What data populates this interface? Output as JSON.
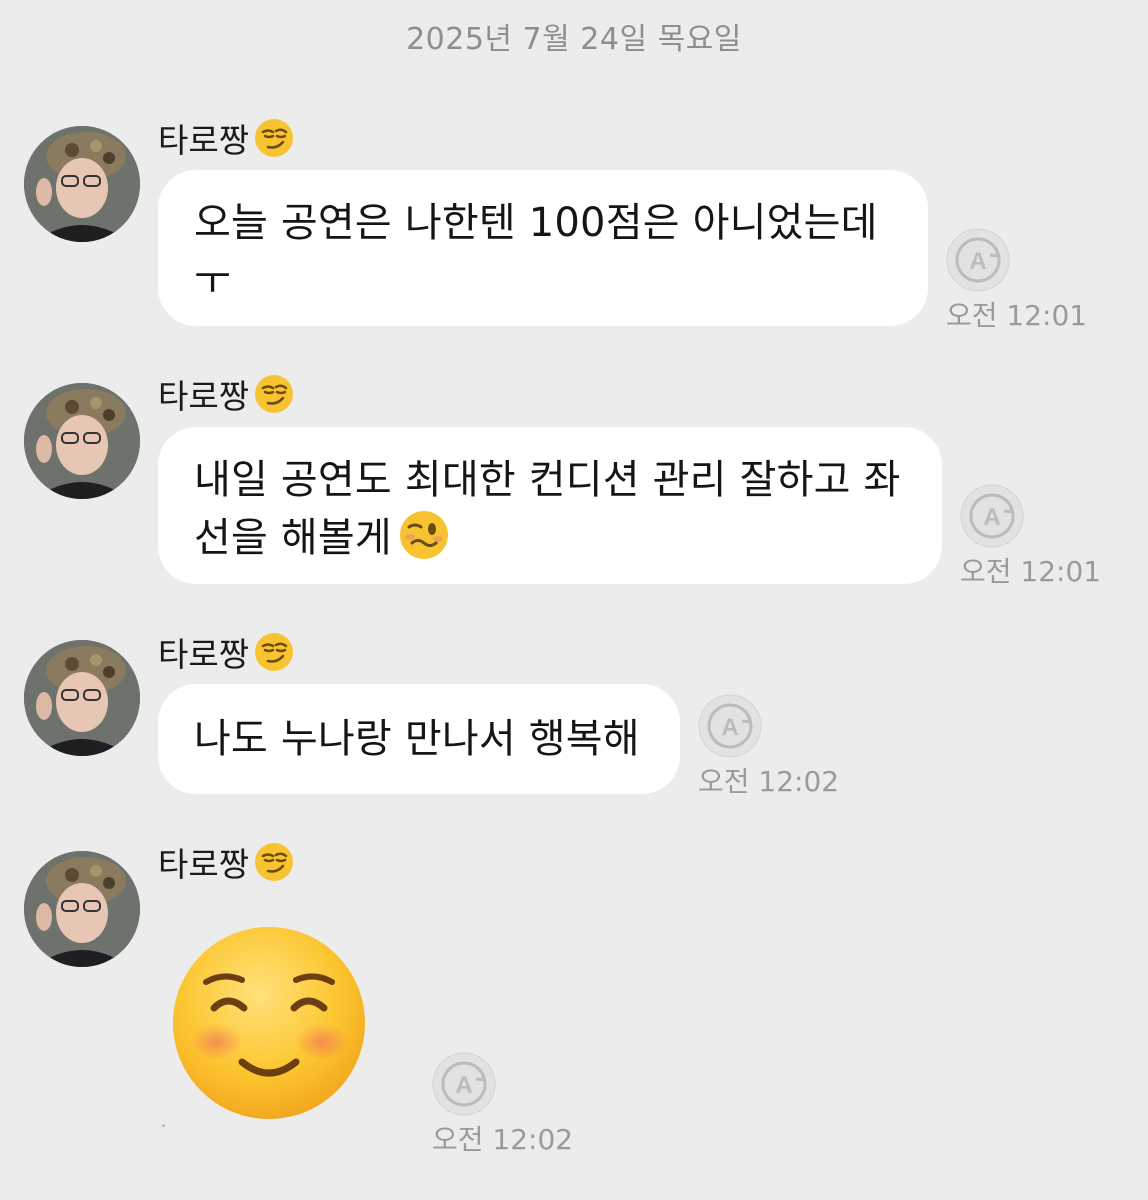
{
  "date_header": "2025년 7월 24일 목요일",
  "sender_name": "타로짱",
  "sender_emoji_icon": "smirking-face-icon",
  "read_icon": "auto-translate-a-icon",
  "colors": {
    "background": "#ececec",
    "bubble": "#ffffff",
    "time": "#9a9a9a",
    "date": "#8e8e8e"
  },
  "messages": [
    {
      "text": "오늘 공연은 나한텐 100점은 아니었는데\nㅜ",
      "time": "오전 12:01"
    },
    {
      "text": "내일 공연도 최대한 컨디션 관리 잘하고 좌\n선을 해볼게",
      "inline_emoji": "woozy-face-icon",
      "time": "오전 12:01"
    },
    {
      "text": "나도 누나랑 만나서 행복해",
      "time": "오전 12:02"
    },
    {
      "emoji": "smiling-face-icon",
      "time": "오전 12:02"
    }
  ]
}
